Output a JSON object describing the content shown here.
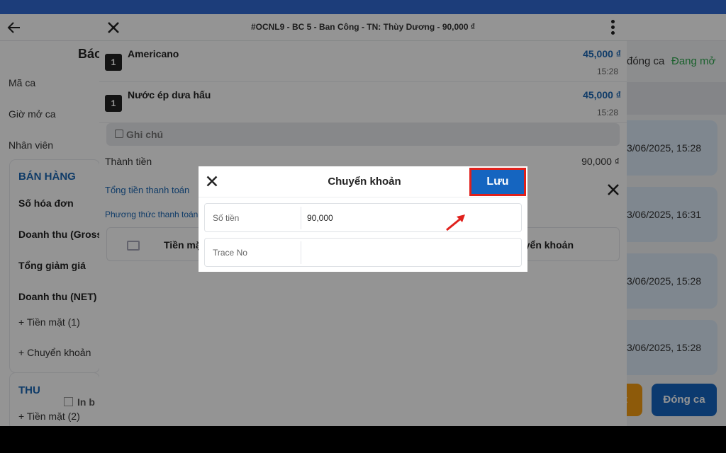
{
  "colors": {
    "accent": "#1565c0",
    "status_open": "#2fa84f",
    "highlight_border": "#e0211c",
    "price": "#1b67b3"
  },
  "background_page": {
    "title_partial": "Báo",
    "fields": [
      "Mã ca",
      "Giờ mở ca",
      "Nhân viên"
    ],
    "sales_section": {
      "title": "BÁN HÀNG",
      "items": [
        "Số hóa đơn",
        "Doanh thu (Gross",
        "Tổng giảm giá",
        "Doanh thu (NET)",
        "+ Tiền mặt (1)",
        "+ Chuyển khoản"
      ]
    },
    "income_section": {
      "title": "THU",
      "item": "+ Tiền mặt (2)"
    },
    "print_checkbox_label": "In b",
    "close_shift_label": "đóng ca",
    "status": "Đang mở",
    "shift_times": [
      "3/06/2025, 15:28",
      "3/06/2025, 16:31",
      "3/06/2025, 15:28",
      "3/06/2025, 15:28"
    ],
    "orange_button_partial": "t",
    "close_shift_button": "Đóng ca"
  },
  "bill": {
    "title": "#OCNL9 - BC 5 - Ban Công - TN: Thùy Dương - 90,000 ₫",
    "items": [
      {
        "qty": "1",
        "name": "Americano",
        "price": "45,000 ₫",
        "time": "15:28"
      },
      {
        "qty": "1",
        "name": "Nước ép dưa hấu",
        "price": "45,000 ₫",
        "time": "15:28"
      }
    ],
    "note_label": "Ghi chú",
    "total_label": "Thành tiền",
    "total_value": "90,000 ₫"
  },
  "payment": {
    "total_label": "Tổng tiền thanh toán",
    "method_label": "Phương thức thanh toán",
    "col_cash": "Tiền mặt",
    "col_transfer": "yển khoản"
  },
  "dialog": {
    "title": "Chuyển khoản",
    "save_label": "Lưu",
    "fields": [
      {
        "label": "Số tiền",
        "value": "90,000"
      },
      {
        "label": "Trace No",
        "value": ""
      }
    ]
  }
}
